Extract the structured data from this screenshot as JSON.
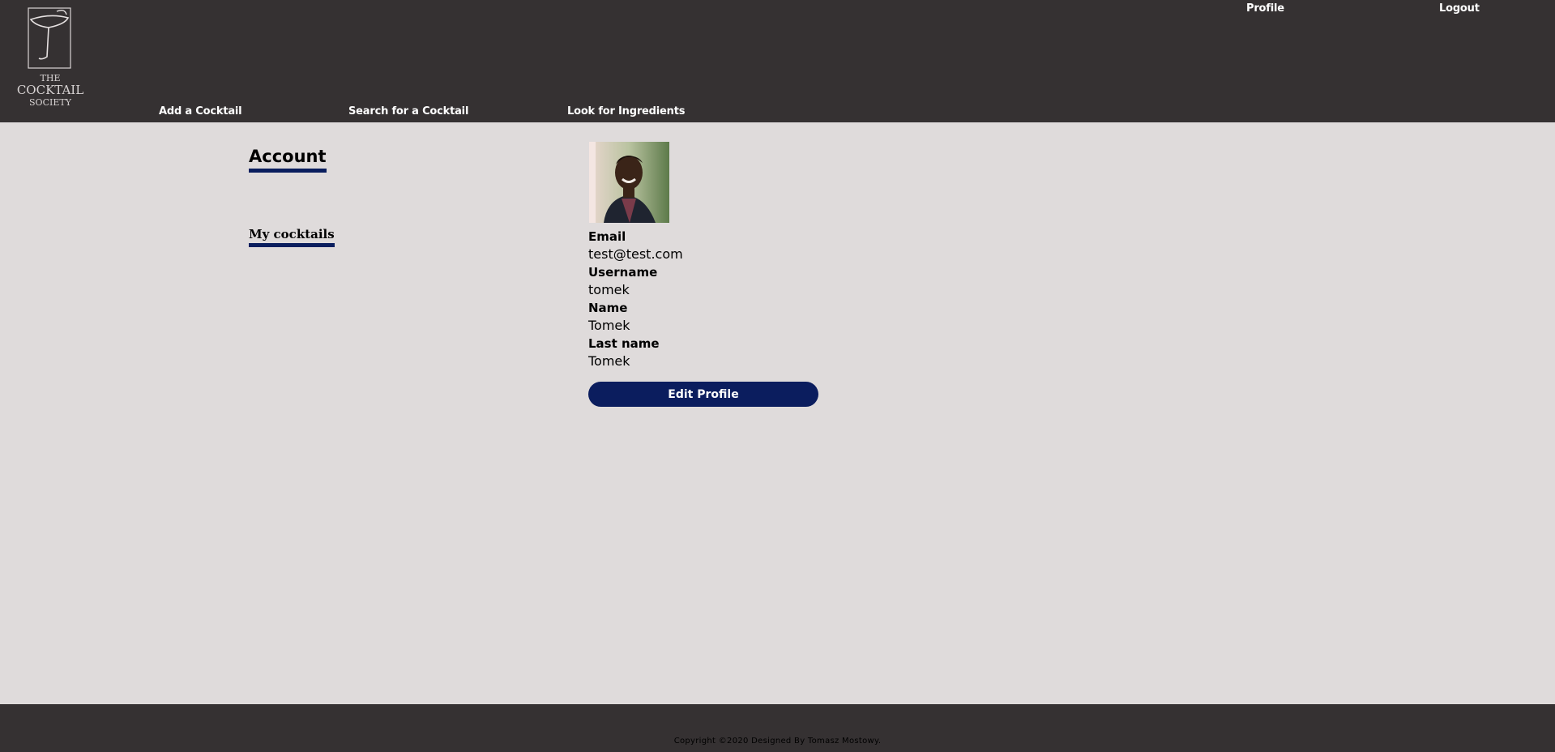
{
  "header": {
    "logo_text_lines": [
      "THE",
      "COCKTAIL",
      "SOCIETY"
    ],
    "top_links": {
      "profile": "Profile",
      "logout": "Logout"
    },
    "nav": {
      "add": "Add a Cocktail",
      "search": "Search for a Cocktail",
      "ingredients": "Look for Ingredients"
    }
  },
  "sidebar": {
    "title": "Account",
    "my_cocktails": "My cocktails"
  },
  "profile": {
    "email_label": "Email",
    "email": "test@test.com",
    "username_label": "Username",
    "username": "tomek",
    "name_label": "Name",
    "name": "Tomek",
    "last_name_label": "Last name",
    "last_name": "Tomek",
    "edit_button": "Edit Profile"
  },
  "footer": {
    "copyright": "Copyright ©2020 Designed By Tomasz Mostowy."
  },
  "colors": {
    "header_bg": "#353132",
    "page_bg": "#dfdbdb",
    "accent": "#0b1d5e"
  }
}
